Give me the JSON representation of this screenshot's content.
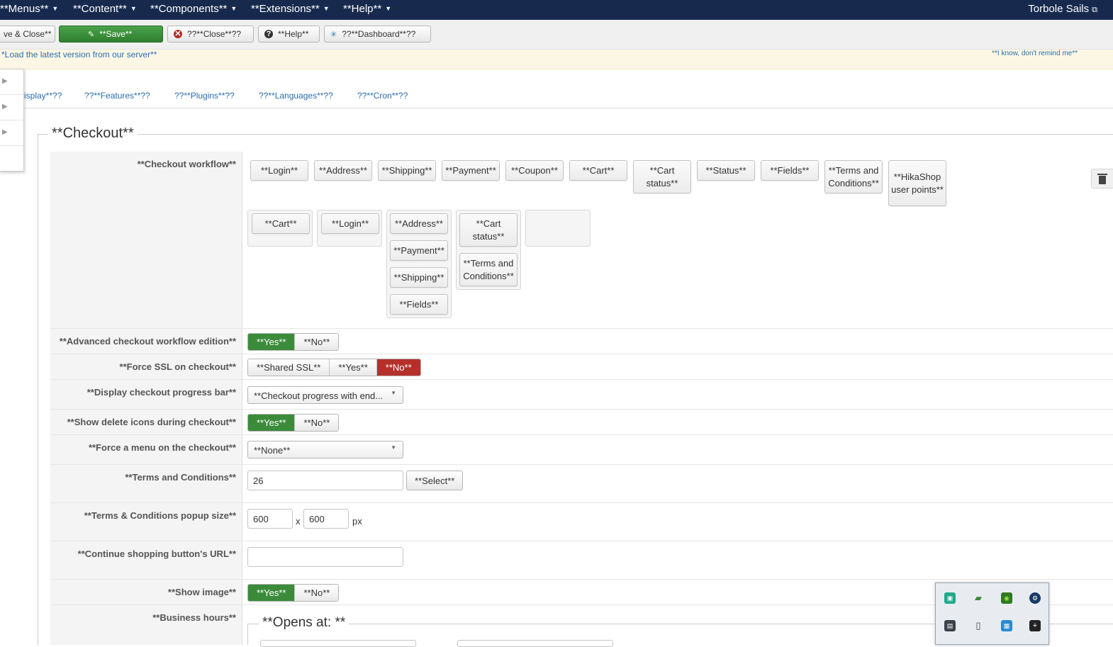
{
  "topnav": {
    "menus": [
      "**Menus**",
      "**Content**",
      "**Components**",
      "**Extensions**",
      "**Help**"
    ],
    "site_link": "Torbole Sails"
  },
  "toolbar": {
    "save_close": "ve & Close**",
    "save": "**Save**",
    "close": "??**Close**??",
    "help": "**Help**",
    "dashboard": "??**Dashboard**??"
  },
  "notice": {
    "load_latest": "*Load the latest version from our server**",
    "dismiss": "**I know, don't remind me**"
  },
  "tabs": [
    "isplay**??",
    "??**Features**??",
    "??**Plugins**??",
    "??**Languages**??",
    "??**Cron**??"
  ],
  "checkout": {
    "legend": "**Checkout**",
    "labels": {
      "workflow": "**Checkout workflow**",
      "advanced": "**Advanced checkout workflow edition**",
      "force_ssl": "**Force SSL on checkout**",
      "progress_bar": "**Display checkout progress bar**",
      "delete_icons": "**Show delete icons during checkout**",
      "force_menu": "**Force a menu on the checkout**",
      "terms": "**Terms and Conditions**",
      "popup_size": "**Terms & Conditions popup size**",
      "continue_url": "**Continue shopping button's URL**",
      "show_image": "**Show image**",
      "business_hours": "**Business hours**"
    },
    "available_steps": [
      "**Login**",
      "**Address**",
      "**Shipping**",
      "**Payment**",
      "**Coupon**",
      "**Cart**",
      "**Cart status**",
      "**Status**",
      "**Fields**",
      "**Terms and Conditions**",
      "**HikaShop user points**"
    ],
    "workflow_groups": [
      [
        "**Cart**"
      ],
      [
        "**Login**"
      ],
      [
        "**Address**",
        "**Payment**",
        "**Shipping**",
        "**Fields**"
      ],
      [
        "**Cart status**",
        "**Terms and Conditions**"
      ],
      []
    ],
    "yes": "**Yes**",
    "no": "**No**",
    "shared_ssl": "**Shared SSL**",
    "progress_value": "**Checkout progress with end...",
    "menu_value": "**None**",
    "terms_value": "26",
    "select_label": "**Select**",
    "popup_width": "600",
    "popup_height": "600",
    "times": "x",
    "px": "px",
    "continue_url_value": "",
    "opens_at": "**Opens at: **",
    "state": {
      "advanced": "yes",
      "force_ssl": "no",
      "delete_icons": "yes",
      "show_image": "yes"
    }
  },
  "colors": {
    "nav_bg": "#172a4e",
    "active_green": "#3b8b3b",
    "active_red": "#b5302b",
    "link_blue": "#2a6db0",
    "notice_bg": "#fcf7e4"
  }
}
